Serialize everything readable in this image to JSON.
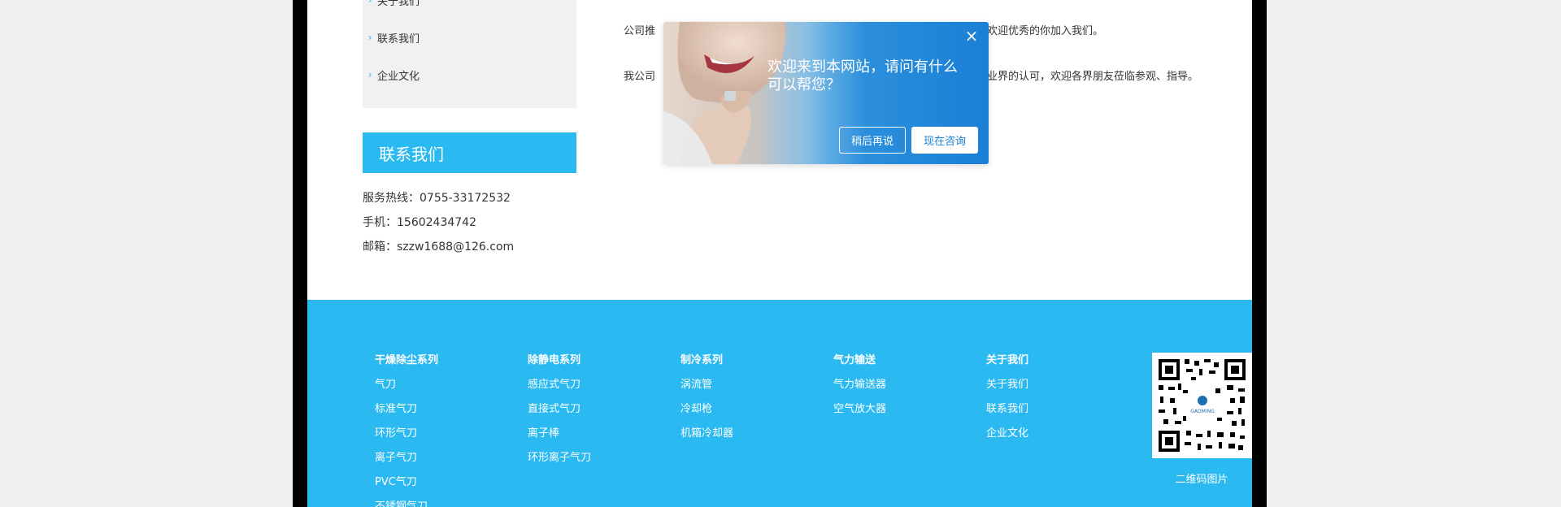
{
  "sidebar": {
    "menu_items": [
      {
        "label": "关于我们"
      },
      {
        "label": "联系我们"
      },
      {
        "label": "企业文化"
      }
    ],
    "contact_title": "联系我们",
    "contact": {
      "hotline": "服务热线：0755-33172532",
      "mobile": "手机：15602434742",
      "email": "邮箱：szzw1688@126.com"
    }
  },
  "article": {
    "line1_left": "公司推",
    "line1_right": "欢迎优秀的你加入我们。",
    "line2_left": "我公司",
    "line2_right": "业界的认可，欢迎各界朋友莅临参观、指导。"
  },
  "modal": {
    "close_label": "×",
    "message": "欢迎来到本网站，请问有什么可以帮您？",
    "later_label": "稍后再说",
    "now_label": "现在咨询"
  },
  "footer": {
    "columns": [
      {
        "heading": "干燥除尘系列",
        "items": [
          "气刀",
          "标准气刀",
          "环形气刀",
          "离子气刀",
          "PVC气刀",
          "不锈钢气刀"
        ]
      },
      {
        "heading": "除静电系列",
        "items": [
          "感应式气刀",
          "直接式气刀",
          "离子棒",
          "环形离子气刀"
        ]
      },
      {
        "heading": "制冷系列",
        "items": [
          "涡流管",
          "冷却枪",
          "机箱冷却器"
        ]
      },
      {
        "heading": "气力输送",
        "items": [
          "气力输送器",
          "空气放大器"
        ]
      },
      {
        "heading": "关于我们",
        "items": [
          "关于我们",
          "联系我们",
          "企业文化"
        ]
      }
    ],
    "qr_caption": "二维码图片",
    "qr_logo_text": "GAOMING"
  },
  "colors": {
    "accent": "#2bb9f2",
    "page_bg": "#efefef",
    "modal_blue": "#1a7fd6"
  }
}
